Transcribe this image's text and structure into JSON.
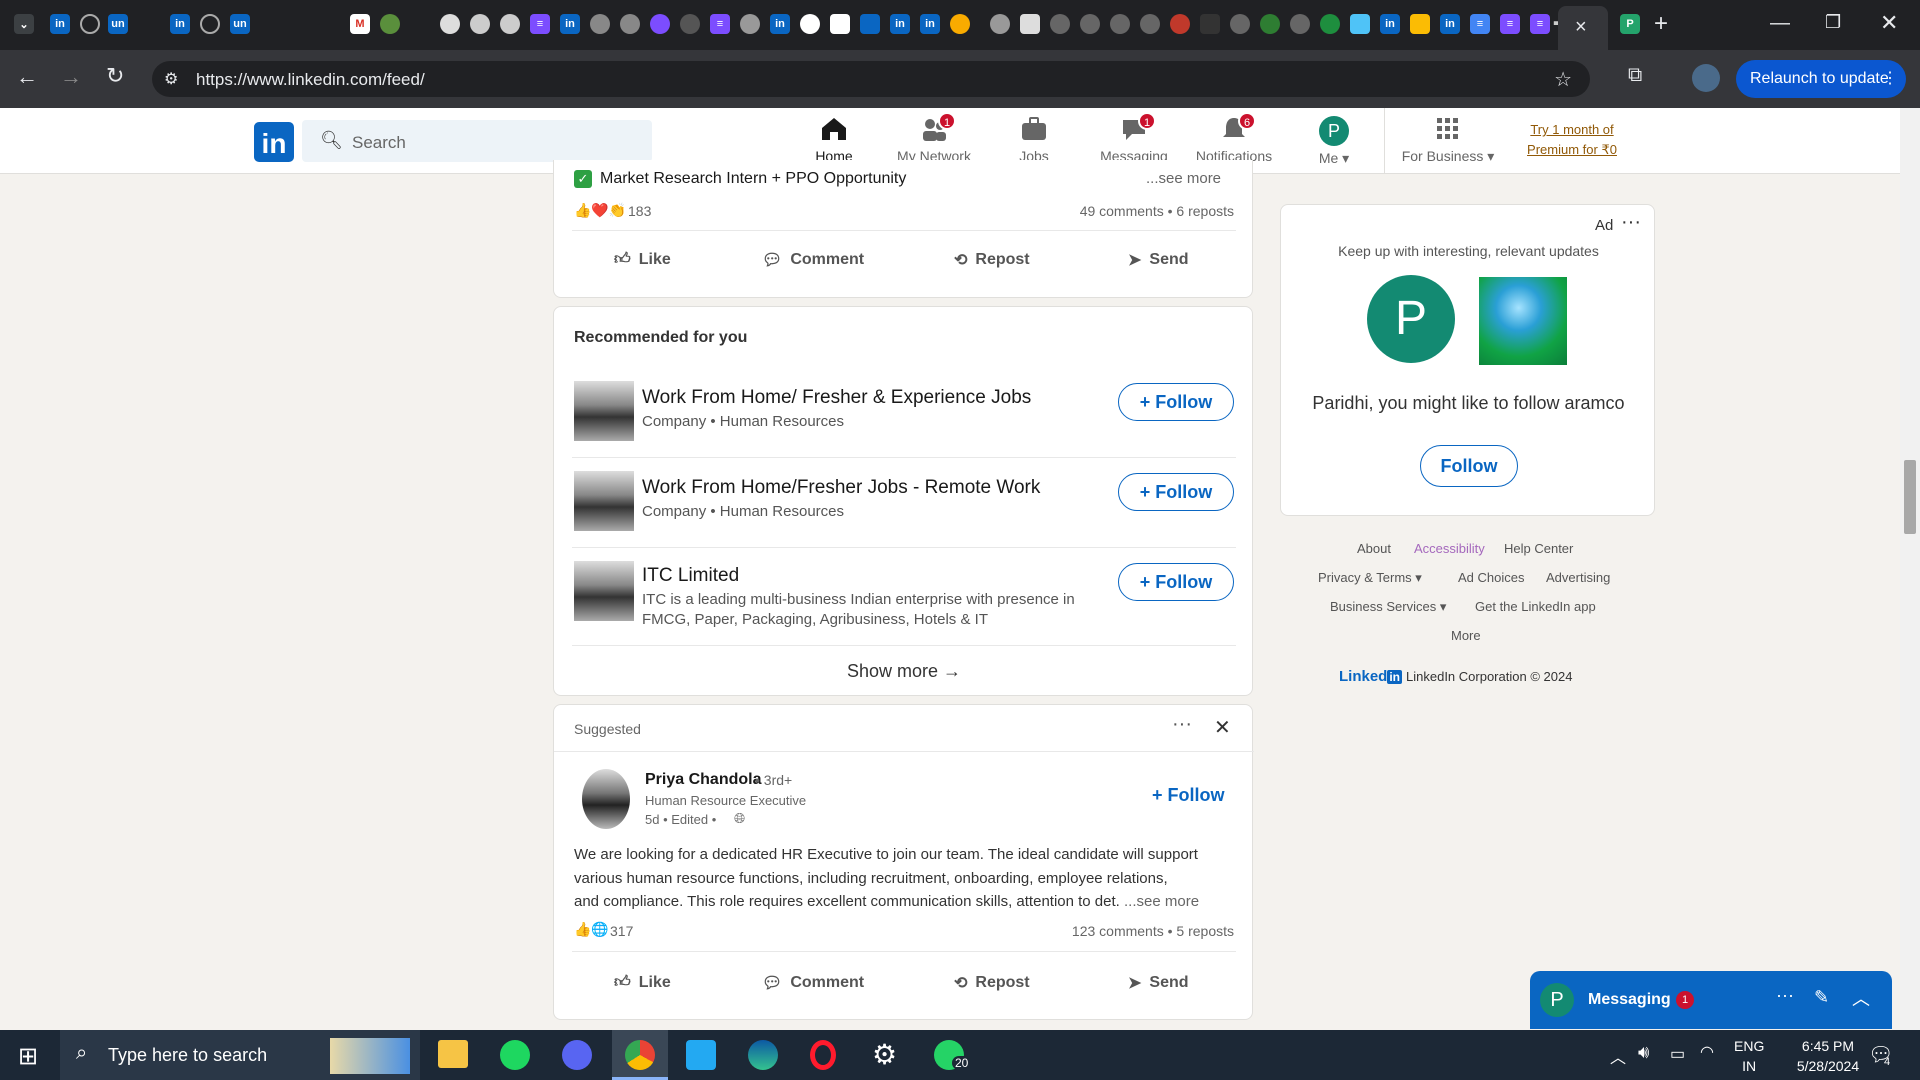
{
  "browser": {
    "url": "https://www.linkedin.com/feed/",
    "relaunch": "Relaunch to update",
    "tab_close": "×",
    "new_tab": "+"
  },
  "header": {
    "search_placeholder": "Search",
    "nav": [
      {
        "label": "Home"
      },
      {
        "label": "My Network",
        "badge": "1"
      },
      {
        "label": "Jobs"
      },
      {
        "label": "Messaging",
        "badge": "1"
      },
      {
        "label": "Notifications",
        "badge": "6"
      },
      {
        "label": "Me"
      },
      {
        "label": "For Business"
      }
    ],
    "avatar_letter": "P",
    "premium": [
      "Try 1 month of",
      "Premium for ₹0"
    ]
  },
  "post1": {
    "text": "Market Research Intern + PPO Opportunity",
    "see_more": "...see more",
    "reactions": "183",
    "stats": "49 comments • 6 reposts"
  },
  "actions": {
    "like": "Like",
    "comment": "Comment",
    "repost": "Repost",
    "send": "Send"
  },
  "recommended": {
    "title": "Recommended for you",
    "items": [
      {
        "name": "Work From Home/ Fresher & Experience Jobs",
        "line1": "Company • Human Resources",
        "line2": ""
      },
      {
        "name": "Work From Home/Fresher Jobs - Remote Work",
        "line1": "Company • Human Resources",
        "line2": ""
      },
      {
        "name": "ITC Limited",
        "line1": "ITC is a leading multi-business Indian enterprise with presence in",
        "line2": "FMCG, Paper, Packaging, Agribusiness, Hotels & IT"
      }
    ],
    "follow": "Follow",
    "show_more": "Show more →"
  },
  "suggested": {
    "label": "Suggested",
    "name": "Priya Chandola",
    "degree": "• 3rd+",
    "title": "Human Resource Executive",
    "meta": "5d • Edited •",
    "follow": "Follow",
    "body": [
      "We are looking for a dedicated HR Executive to join our team. The ideal candidate will support",
      "various human resource functions, including recruitment, onboarding, employee relations,",
      "and compliance. This role requires excellent communication skills, attention to det."
    ],
    "see_more": "...see more",
    "reactions": "317",
    "stats": "123 comments • 5 reposts"
  },
  "ad": {
    "label": "Ad",
    "tagline": "Keep up with interesting, relevant updates",
    "avatar_letter": "P",
    "message": "Paridhi, you might like to follow aramco",
    "follow": "Follow"
  },
  "footer": {
    "links_row1": [
      "About",
      "Accessibility",
      "Help Center"
    ],
    "links_row2": [
      "Privacy & Terms",
      "Ad Choices",
      "Advertising"
    ],
    "links_row3": [
      "Business Services",
      "Get the LinkedIn app"
    ],
    "more": "More",
    "brand": "Linked",
    "brand_in": "in",
    "copyright": "LinkedIn Corporation © 2024"
  },
  "messaging": {
    "label": "Messaging",
    "badge": "1",
    "avatar_letter": "P"
  },
  "taskbar": {
    "search": "Type here to search",
    "whatsapp_badge": "20",
    "lang1": "ENG",
    "lang2": "IN",
    "time": "6:45 PM",
    "date": "5/28/2024",
    "notif_count": "4"
  },
  "colors": {
    "brand": "#0a66c2",
    "badge": "#cb112d",
    "accessibility": "#a569bd"
  }
}
